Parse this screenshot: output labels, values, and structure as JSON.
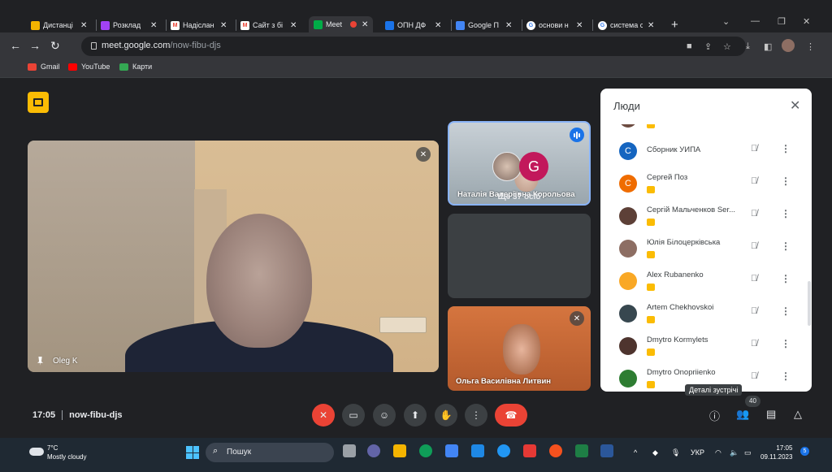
{
  "browser": {
    "tabs": [
      {
        "title": "Дистанці",
        "favicon": "mn-icon",
        "color": "#f4b400"
      },
      {
        "title": "Розклад",
        "favicon": "schedule-icon",
        "color": "#a142f4"
      },
      {
        "title": "Надіслан",
        "favicon": "gmail-icon",
        "color": "#ea4335"
      },
      {
        "title": "Сайт з бі",
        "favicon": "gmail-icon",
        "color": "#ea4335"
      },
      {
        "title": "Meet",
        "favicon": "meet-icon",
        "color": "#00ac47",
        "active": true
      },
      {
        "title": "ОПН ДФ",
        "favicon": "form-icon",
        "color": "#1a73e8"
      },
      {
        "title": "Google П",
        "favicon": "slides-icon",
        "color": "#4285f4"
      },
      {
        "title": "основи н",
        "favicon": "google-icon",
        "color": "#ffffff"
      },
      {
        "title": "система с",
        "favicon": "google-icon",
        "color": "#ffffff"
      }
    ],
    "new_tab": "+",
    "url_host": "meet.google.com",
    "url_path": "/now-fibu-djs",
    "bookmarks": [
      {
        "label": "Gmail",
        "color": "#ea4335"
      },
      {
        "label": "YouTube",
        "color": "#ff0000"
      },
      {
        "label": "Карти",
        "color": "#34a853"
      }
    ]
  },
  "meet": {
    "main_participant": "Oleg K",
    "tiles": [
      {
        "name": "Наталія Валеріївна Корольова"
      },
      {
        "more_label": "Ще 37 осіб",
        "avatar_letter": "G"
      },
      {
        "name": "Ольга Василівна Литвин"
      }
    ],
    "people_panel": {
      "title": "Люди",
      "participants": [
        {
          "name": "",
          "avatar": "photo",
          "color": "#6d4c41"
        },
        {
          "name": "Сборник УИПА",
          "avatar": "С",
          "color": "#1565c0"
        },
        {
          "name": "Сергей Поз",
          "avatar": "С",
          "color": "#ef6c00"
        },
        {
          "name": "Сергій Мальченков Ser...",
          "avatar": "photo",
          "color": "#5d4037"
        },
        {
          "name": "Юлія Білоцерківська",
          "avatar": "photo",
          "color": "#8d6e63"
        },
        {
          "name": "Alex Rubanenko",
          "avatar": "photo",
          "color": "#f9a825"
        },
        {
          "name": "Artem Chekhovskoi",
          "avatar": "photo",
          "color": "#37474f"
        },
        {
          "name": "Dmytro Kormylets",
          "avatar": "photo",
          "color": "#4e342e"
        },
        {
          "name": "Dmytro Onopriienko",
          "avatar": "photo",
          "color": "#2e7d32"
        }
      ]
    },
    "bottom_bar": {
      "time": "17:05",
      "meeting_code": "now-fibu-djs",
      "tooltip": "Деталі зустрічі",
      "people_count": "40"
    }
  },
  "taskbar": {
    "temperature": "7°C",
    "weather": "Mostly cloudy",
    "search_placeholder": "Пошук",
    "language": "УКР",
    "time": "17:05",
    "date": "09.11.2023",
    "notifications": "5"
  }
}
